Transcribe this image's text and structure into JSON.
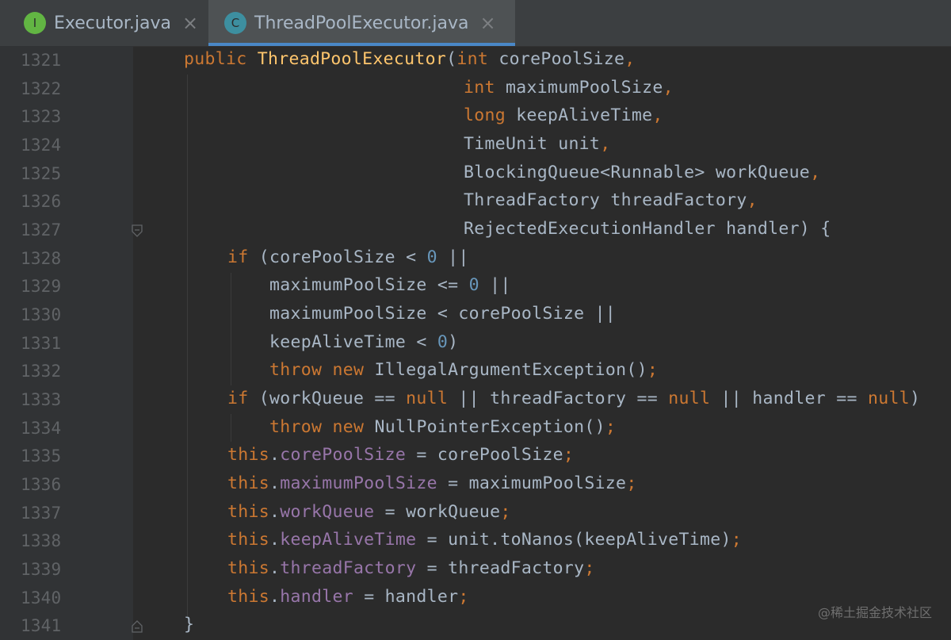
{
  "tabs": [
    {
      "icon": "I",
      "icon_name": "interface-icon",
      "label": "Executor.java",
      "close": "×",
      "active": false
    },
    {
      "icon": "C",
      "icon_name": "class-icon",
      "label": "ThreadPoolExecutor.java",
      "close": "×",
      "active": true
    }
  ],
  "line_numbers": [
    "1321",
    "1322",
    "1323",
    "1324",
    "1325",
    "1326",
    "1327",
    "1328",
    "1329",
    "1330",
    "1331",
    "1332",
    "1333",
    "1334",
    "1335",
    "1336",
    "1337",
    "1338",
    "1339",
    "1340",
    "1341"
  ],
  "code": {
    "l1321": {
      "kw_public": "public ",
      "ctor": "ThreadPoolExecutor",
      "paren": "(",
      "kw_int": "int",
      "rest": " corePoolSize",
      "comma": ","
    },
    "l1322": {
      "kw_int": "int",
      "rest": " maximumPoolSize",
      "comma": ","
    },
    "l1323": {
      "kw_long": "long",
      "rest": " keepAliveTime",
      "comma": ","
    },
    "l1324": {
      "rest": "TimeUnit unit",
      "comma": ","
    },
    "l1325": {
      "rest": "BlockingQueue<Runnable> workQueue",
      "comma": ","
    },
    "l1326": {
      "rest": "ThreadFactory threadFactory",
      "comma": ","
    },
    "l1327": {
      "rest": "RejectedExecutionHandler handler) {"
    },
    "l1328": {
      "kw_if": "if",
      "a": " (corePoolSize < ",
      "num": "0",
      "b": " ||"
    },
    "l1329": {
      "a": "maximumPoolSize <= ",
      "num": "0",
      "b": " ||"
    },
    "l1330": {
      "a": "maximumPoolSize < corePoolSize ||"
    },
    "l1331": {
      "a": "keepAliveTime < ",
      "num": "0",
      "b": ")"
    },
    "l1332": {
      "kw_throw": "throw",
      "sp": " ",
      "kw_new": "new",
      "a": " IllegalArgumentException()",
      "semi": ";"
    },
    "l1333": {
      "kw_if": "if",
      "a": " (workQueue == ",
      "null1": "null",
      "b": " || threadFactory == ",
      "null2": "null",
      "c": " || handler == ",
      "null3": "null",
      "d": ")"
    },
    "l1334": {
      "kw_throw": "throw",
      "sp": " ",
      "kw_new": "new",
      "a": " NullPointerException()",
      "semi": ";"
    },
    "l1335": {
      "kw_this": "this",
      "dot": ".",
      "field": "corePoolSize",
      "a": " = corePoolSize",
      "semi": ";"
    },
    "l1336": {
      "kw_this": "this",
      "dot": ".",
      "field": "maximumPoolSize",
      "a": " = maximumPoolSize",
      "semi": ";"
    },
    "l1337": {
      "kw_this": "this",
      "dot": ".",
      "field": "workQueue",
      "a": " = workQueue",
      "semi": ";"
    },
    "l1338": {
      "kw_this": "this",
      "dot": ".",
      "field": "keepAliveTime",
      "a": " = unit.toNanos(keepAliveTime)",
      "semi": ";"
    },
    "l1339": {
      "kw_this": "this",
      "dot": ".",
      "field": "threadFactory",
      "a": " = threadFactory",
      "semi": ";"
    },
    "l1340": {
      "kw_this": "this",
      "dot": ".",
      "field": "handler",
      "a": " = handler",
      "semi": ";"
    },
    "l1341": {
      "a": "}"
    }
  },
  "watermark": "@稀土掘金技术社区",
  "colors": {
    "background": "#2b2b2b",
    "keyword": "#cc7832",
    "method": "#ffc66d",
    "number": "#6897bb",
    "field": "#9876aa",
    "text": "#a9b7c6",
    "tab_underline": "#4a88c7"
  }
}
